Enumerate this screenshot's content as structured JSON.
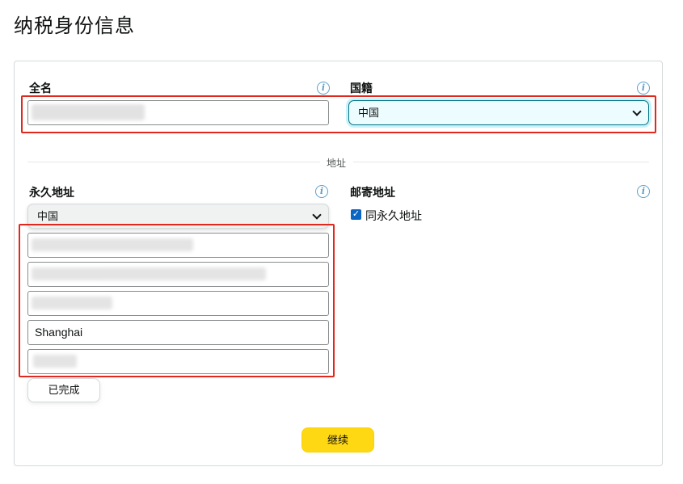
{
  "page": {
    "title": "纳税身份信息"
  },
  "full_name": {
    "label": "全名",
    "value": ""
  },
  "nationality": {
    "label": "国籍",
    "selected": "中国"
  },
  "address_divider": "地址",
  "permanent_address": {
    "label": "永久地址",
    "country": "中国",
    "fields": [
      {
        "value": ""
      },
      {
        "value": ""
      },
      {
        "value": ""
      },
      {
        "value": "Shanghai"
      },
      {
        "value": ""
      }
    ]
  },
  "mailing_address": {
    "label": "邮寄地址",
    "same_as_label": "同永久地址",
    "same_as_checked": true
  },
  "buttons": {
    "done": "已完成",
    "continue": "继续"
  },
  "icons": {
    "info": "info-icon",
    "chevron": "chevron-down-icon",
    "check": "checkmark-icon"
  },
  "colors": {
    "primary_button": "#ffd814",
    "highlight_box": "#e0281e",
    "focus": "#007185"
  }
}
